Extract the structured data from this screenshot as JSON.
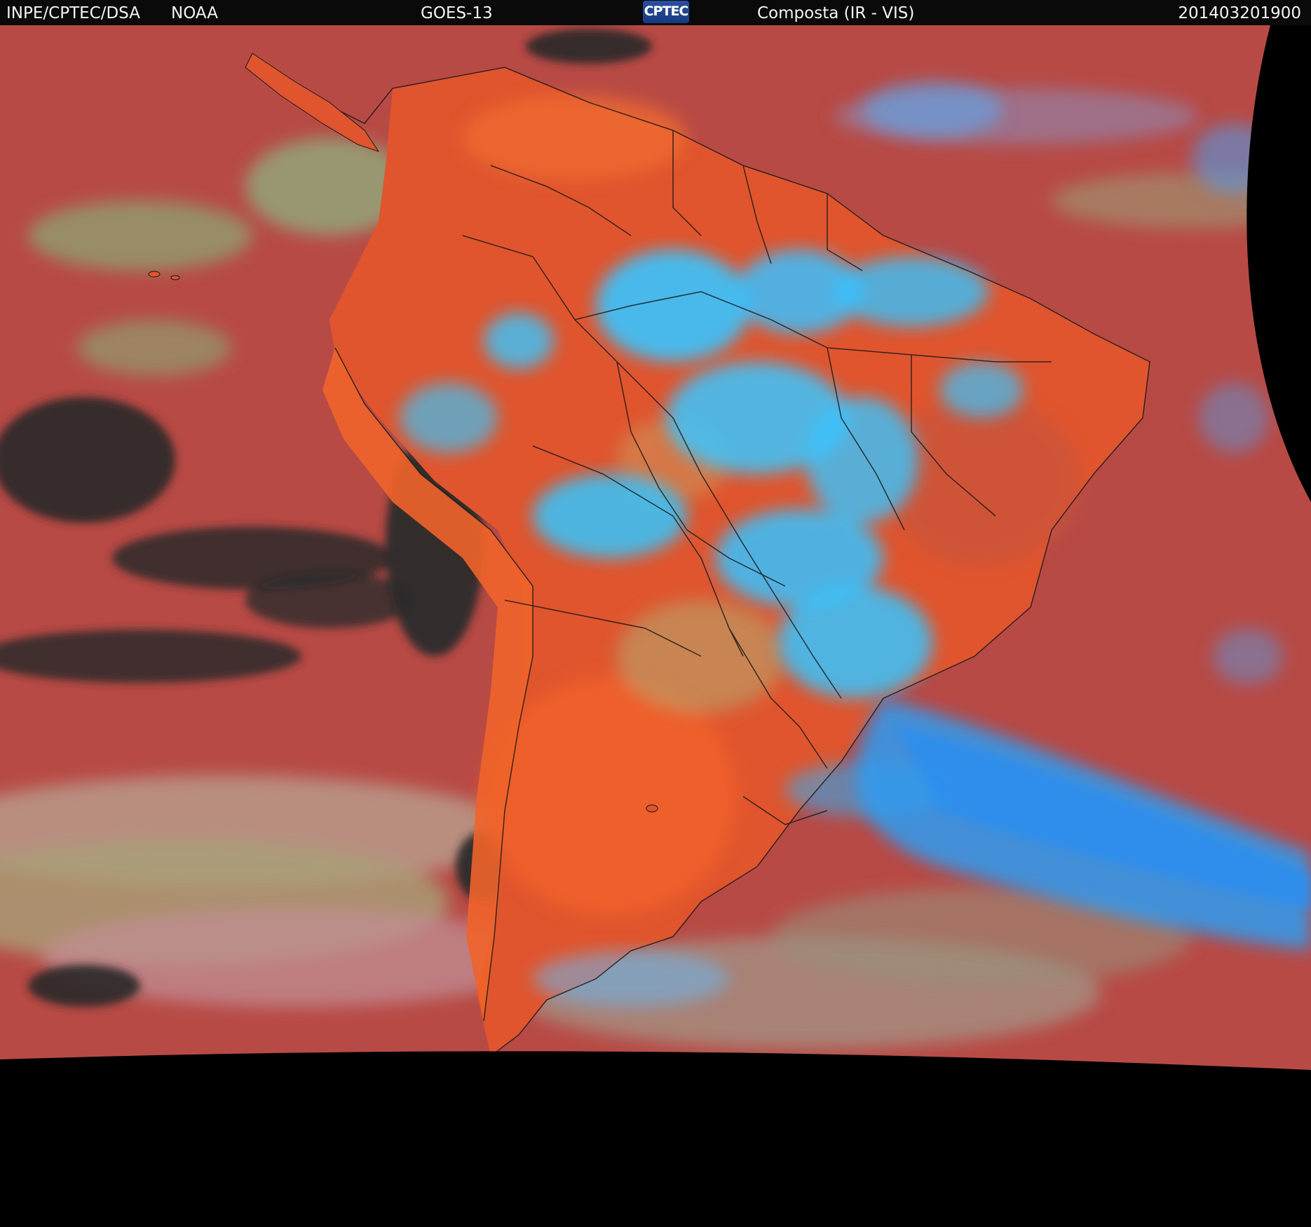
{
  "header": {
    "source": "INPE/CPTEC/DSA",
    "agency": "NOAA",
    "satellite": "GOES-13",
    "logo_text": "CPTEC",
    "product": "Composta (IR - VIS)",
    "timestamp": "201403201900"
  },
  "colors": {
    "header_bg": "#0a0a0a",
    "ocean_warm": "#b84a45",
    "land_warm": "#e85a2c",
    "cold_cloud": "#33c8ff",
    "low_cloud": "#9aaf70",
    "cloud_free_sea": "#2a2a2a",
    "no_data": "#000000",
    "border_line": "#1a1a1a"
  }
}
